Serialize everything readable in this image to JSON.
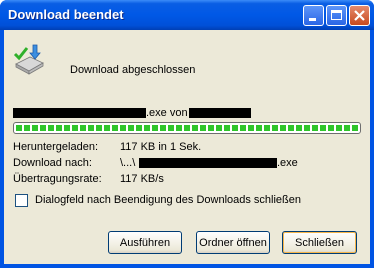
{
  "window": {
    "title": "Download beendet"
  },
  "header": {
    "status": "Download abgeschlossen"
  },
  "file": {
    "name_suffix": ".exe von"
  },
  "progress": {
    "fraction": 1.0
  },
  "details": {
    "downloaded_label": "Heruntergeladen:",
    "downloaded_value": "117 KB in 1 Sek.",
    "target_label": "Download nach:",
    "target_prefix": "\\...\\",
    "target_suffix": ".exe",
    "rate_label": "Übertragungsrate:",
    "rate_value": "117 KB/s"
  },
  "options": {
    "close_on_complete_label": "Dialogfeld nach Beendigung des Downloads schließen",
    "close_on_complete_checked": false
  },
  "buttons": {
    "run": "Ausführen",
    "open_folder": "Ordner öffnen",
    "close": "Schließen"
  },
  "colors": {
    "titlebar": "#0058e6",
    "client": "#ece9d8",
    "progress": "#2fc52a"
  },
  "icons": [
    "download-complete-icon",
    "minimize-icon",
    "maximize-icon",
    "close-icon"
  ]
}
